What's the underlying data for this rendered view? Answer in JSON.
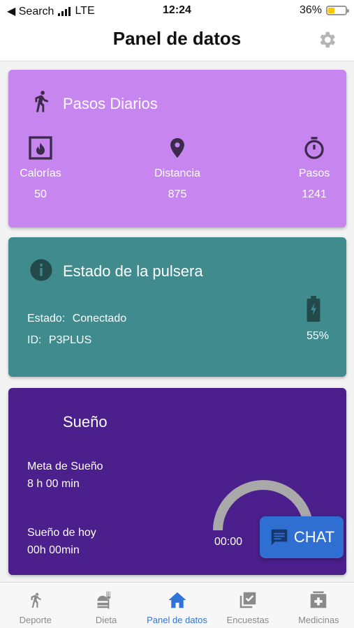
{
  "status": {
    "back_label": "◀ Search",
    "network": "LTE",
    "time": "12:24",
    "battery_pct": "36%",
    "battery_level": 0.36
  },
  "header": {
    "title": "Panel de datos",
    "settings_icon": "gear-icon"
  },
  "steps_card": {
    "title": "Pasos Diarios",
    "color": "#c685ef",
    "metrics": [
      {
        "label": "Calorías",
        "value": "50",
        "icon": "calories-icon"
      },
      {
        "label": "Distancia",
        "value": "875",
        "icon": "location-pin-icon"
      },
      {
        "label": "Pasos",
        "value": "1241",
        "icon": "stopwatch-icon"
      }
    ]
  },
  "band_card": {
    "title": "Estado de la pulsera",
    "color": "#3f8b8e",
    "status_label": "Estado:",
    "status_value": "Conectado",
    "id_label": "ID:",
    "id_value": "P3PLUS",
    "battery": "55%"
  },
  "sleep_card": {
    "title": "Sueño",
    "color": "#4b1f8c",
    "goal_label": "Meta de Sueño",
    "goal_value": "8 h 00 min",
    "today_label": "Sueño de hoy",
    "today_value": "00h 00min",
    "gauge_value": "00:00"
  },
  "chat": {
    "label": "CHAT"
  },
  "nav": [
    {
      "label": "Deporte",
      "icon": "sport-icon"
    },
    {
      "label": "Dieta",
      "icon": "diet-icon"
    },
    {
      "label": "Panel de datos",
      "icon": "home-icon",
      "active": true
    },
    {
      "label": "Encuestas",
      "icon": "survey-icon"
    },
    {
      "label": "Medicinas",
      "icon": "medicine-icon"
    }
  ]
}
